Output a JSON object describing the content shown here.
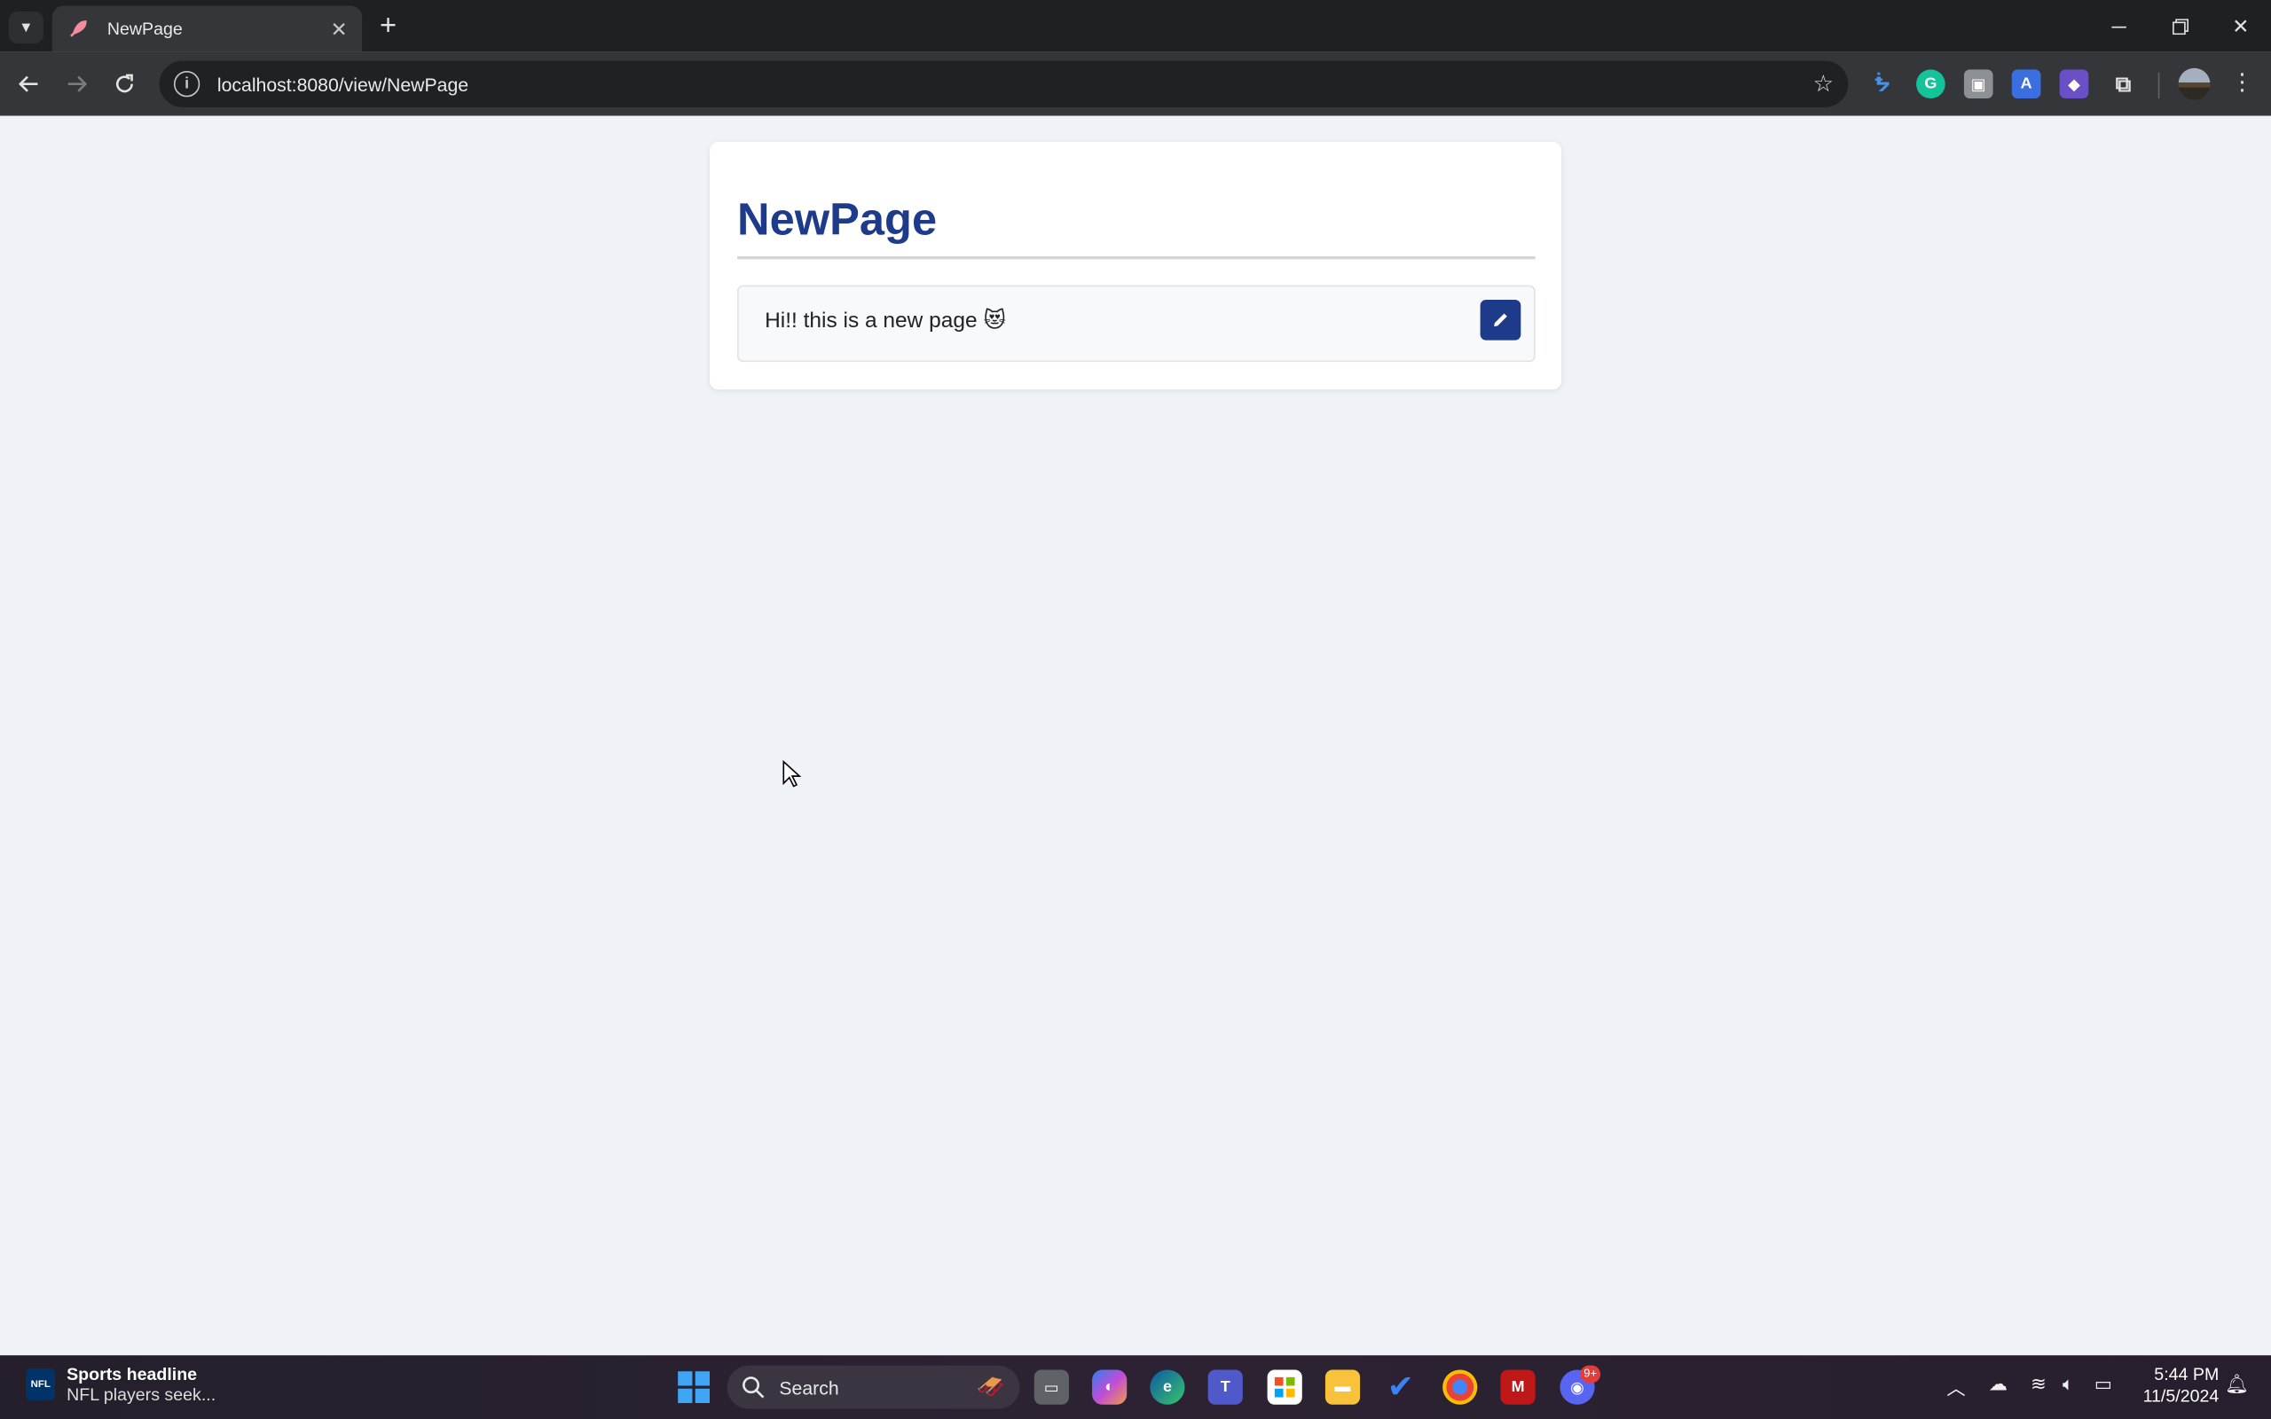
{
  "browser": {
    "tab_title": "NewPage",
    "url": "localhost:8080/view/NewPage"
  },
  "page": {
    "title": "NewPage",
    "content_text": "Hi!! this is a new page",
    "content_emoji": "😻"
  },
  "taskbar": {
    "widget_headline": "Sports headline",
    "widget_subtext": "NFL players seek...",
    "search_label": "Search",
    "discord_badge": "9+",
    "time": "5:44 PM",
    "date": "11/5/2024"
  },
  "colors": {
    "accent": "#1e3a8a",
    "page_bg": "#eff2f7"
  }
}
